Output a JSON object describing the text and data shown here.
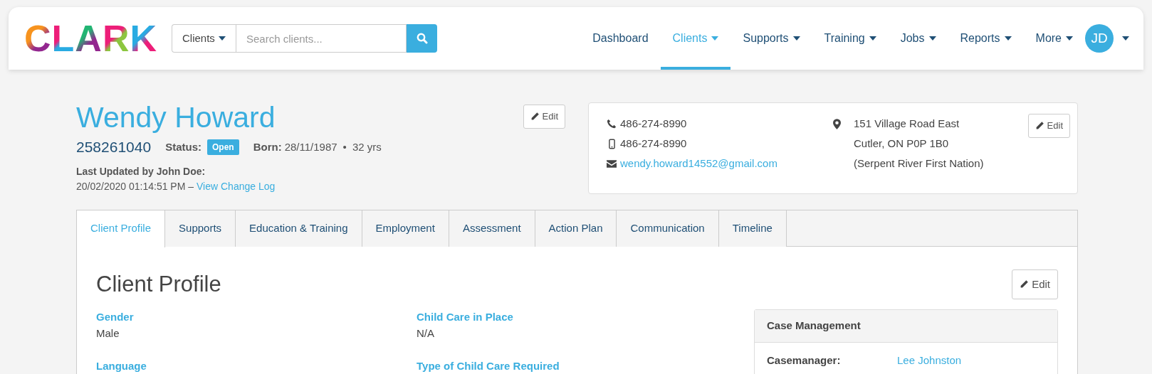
{
  "logo": {
    "text": "CLARK"
  },
  "search": {
    "scope": "Clients",
    "placeholder": "Search clients..."
  },
  "nav": [
    {
      "label": "Dashboard",
      "selected": false,
      "dropdown": false
    },
    {
      "label": "Clients",
      "selected": true,
      "dropdown": true
    },
    {
      "label": "Supports",
      "selected": false,
      "dropdown": true
    },
    {
      "label": "Training",
      "selected": false,
      "dropdown": true
    },
    {
      "label": "Jobs",
      "selected": false,
      "dropdown": true
    },
    {
      "label": "Reports",
      "selected": false,
      "dropdown": true
    },
    {
      "label": "More",
      "selected": false,
      "dropdown": true
    }
  ],
  "user": {
    "initials": "JD"
  },
  "client": {
    "name": "Wendy Howard",
    "id": "258261040",
    "status_label": "Status:",
    "status": "Open",
    "born_label": "Born:",
    "born": "28/11/1987",
    "separator": "•",
    "age": "32 yrs",
    "updated_by": "Last Updated by John Doe:",
    "updated_at": "20/02/2020 01:14:51 PM –",
    "change_log_link": "View Change Log",
    "edit_button": "Edit"
  },
  "contact": {
    "phone": "486-274-8990",
    "mobile": "486-274-8990",
    "email": "wendy.howard14552@gmail.com",
    "address": [
      "151 Village Road East",
      "Cutler, ON P0P 1B0",
      "(Serpent River First Nation)"
    ],
    "edit_button": "Edit"
  },
  "tabs": [
    {
      "label": "Client Profile",
      "selected": true
    },
    {
      "label": "Supports",
      "selected": false
    },
    {
      "label": "Education & Training",
      "selected": false
    },
    {
      "label": "Employment",
      "selected": false
    },
    {
      "label": "Assessment",
      "selected": false
    },
    {
      "label": "Action Plan",
      "selected": false
    },
    {
      "label": "Communication",
      "selected": false
    },
    {
      "label": "Timeline",
      "selected": false
    }
  ],
  "profile": {
    "title": "Client Profile",
    "edit_button": "Edit",
    "columns": [
      [
        {
          "label": "Gender",
          "value": "Male"
        },
        {
          "label": "Language"
        }
      ],
      [
        {
          "label": "Child Care in Place",
          "value": "N/A"
        },
        {
          "label": "Type of Child Care Required"
        }
      ]
    ],
    "case_management": {
      "title": "Case Management",
      "rows": [
        {
          "label": "Casemanager:",
          "value": "Lee Johnston"
        }
      ]
    }
  }
}
